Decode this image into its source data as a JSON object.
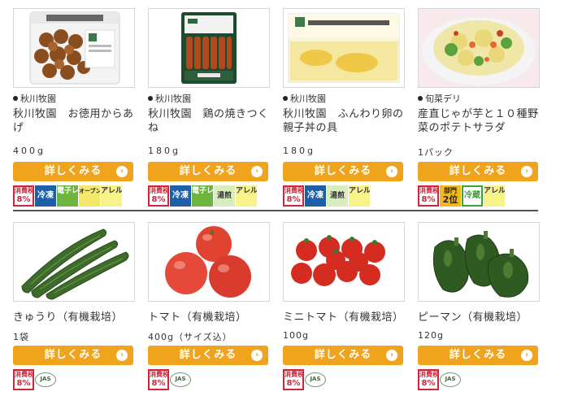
{
  "button_label": "詳しくみる",
  "chevron": "›",
  "colors": {
    "button": "#f0a31c",
    "tax": "#d0263b",
    "frozen": "#1f5fa8"
  },
  "row1": [
    {
      "brand": "秋川牧園",
      "name": "秋川牧園　お徳用からあげ",
      "qty": "400g",
      "badges": [
        {
          "type": "tax",
          "l1": "消費税",
          "l2": "8%"
        },
        {
          "type": "frozen",
          "text": "冷凍"
        },
        {
          "type": "micro",
          "text": "電子レンジ"
        },
        {
          "type": "oven",
          "text": "オーブントースター"
        },
        {
          "type": "aller",
          "text": "アレルゲン"
        }
      ]
    },
    {
      "brand": "秋川牧園",
      "name": "秋川牧園　鶏の焼きつくね",
      "qty": "180g",
      "badges": [
        {
          "type": "tax",
          "l1": "消費税",
          "l2": "8%"
        },
        {
          "type": "frozen",
          "text": "冷凍"
        },
        {
          "type": "micro",
          "text": "電子レンジ"
        },
        {
          "type": "yusen",
          "text": "湯煎"
        },
        {
          "type": "aller",
          "text": "アレルゲン"
        }
      ]
    },
    {
      "brand": "秋川牧園",
      "name": "秋川牧園　ふんわり卵の親子丼の具",
      "qty": "180g",
      "badges": [
        {
          "type": "tax",
          "l1": "消費税",
          "l2": "8%"
        },
        {
          "type": "frozen",
          "text": "冷凍"
        },
        {
          "type": "yusen",
          "text": "湯煎"
        },
        {
          "type": "aller",
          "text": "アレルゲン"
        }
      ]
    },
    {
      "brand": "旬菜デリ",
      "name": "産直じゃが芋と１０種野菜のポテトサラダ",
      "qty": "1パック",
      "badges": [
        {
          "type": "tax",
          "l1": "消費税",
          "l2": "8%"
        },
        {
          "type": "rank",
          "l1": "部門",
          "l2": "2位"
        },
        {
          "type": "chilled",
          "text": "冷蔵"
        },
        {
          "type": "aller",
          "text": "アレルゲン"
        }
      ]
    }
  ],
  "row2": [
    {
      "name": "きゅうり（有機栽培）",
      "qty": "1袋",
      "badges": [
        {
          "type": "tax",
          "l1": "消費税",
          "l2": "8%"
        },
        {
          "type": "jas",
          "text": "JAS"
        }
      ]
    },
    {
      "name": "トマト（有機栽培）",
      "qty": "400g（サイズ込）",
      "badges": [
        {
          "type": "tax",
          "l1": "消費税",
          "l2": "8%"
        },
        {
          "type": "jas",
          "text": "JAS"
        }
      ]
    },
    {
      "name": "ミニトマト（有機栽培）",
      "qty": "100g",
      "badges": [
        {
          "type": "tax",
          "l1": "消費税",
          "l2": "8%"
        },
        {
          "type": "jas",
          "text": "JAS"
        }
      ]
    },
    {
      "name": "ピーマン（有機栽培）",
      "qty": "120g",
      "badges": [
        {
          "type": "tax",
          "l1": "消費税",
          "l2": "8%"
        },
        {
          "type": "jas",
          "text": "JAS"
        }
      ]
    }
  ]
}
